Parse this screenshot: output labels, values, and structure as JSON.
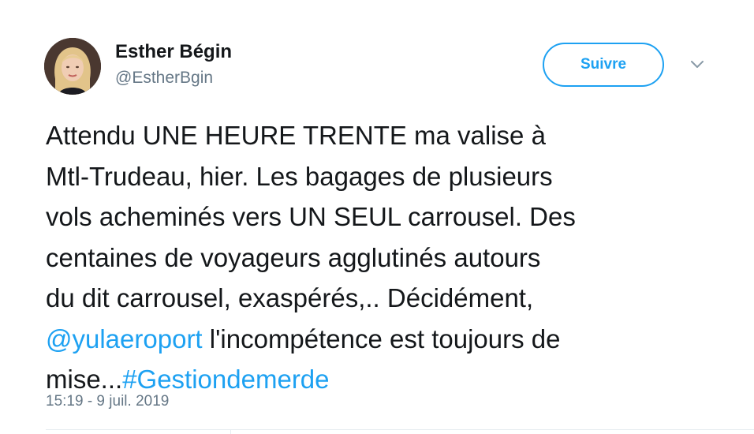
{
  "user": {
    "name": "Esther Bégin",
    "handle": "@EstherBgin",
    "avatar_icon": "profile-photo"
  },
  "follow_button": {
    "label": "Suivre"
  },
  "more_menu_icon": "chevron-down-icon",
  "tweet": {
    "lines": [
      [
        {
          "text": "Attendu UNE HEURE TRENTE ma valise à"
        }
      ],
      [
        {
          "text": "Mtl-Trudeau, hier. Les bagages de plusieurs"
        }
      ],
      [
        {
          "text": "vols acheminés vers UN SEUL carrousel. Des"
        }
      ],
      [
        {
          "text": "centaines de voyageurs agglutinés autours"
        }
      ],
      [
        {
          "text": "du dit carrousel, exaspérés,.. Décidément,"
        }
      ],
      [
        {
          "text": "@yulaeroport",
          "link": true
        },
        {
          "text": " l'incompétence est toujours de"
        }
      ],
      [
        {
          "text": "mise..."
        },
        {
          "text": "#Gestiondemerde",
          "link": true
        }
      ]
    ],
    "timestamp": "15:19 - 9 juil. 2019"
  },
  "colors": {
    "link": "#1da1f2",
    "text": "#14171a",
    "secondary": "#657786",
    "divider": "#e6ecf0"
  }
}
